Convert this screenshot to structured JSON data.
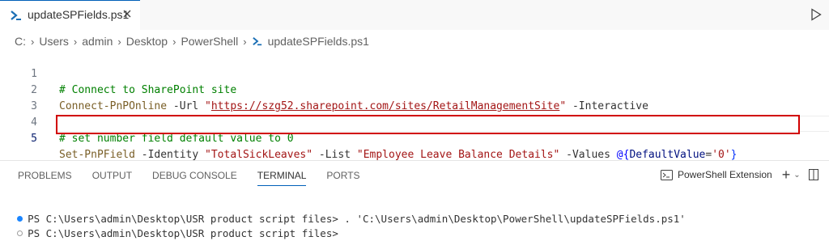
{
  "tab": {
    "filename": "updateSPFields.ps1"
  },
  "breadcrumb": [
    "C:",
    "Users",
    "admin",
    "Desktop",
    "PowerShell",
    "updateSPFields.ps1"
  ],
  "editor": {
    "lines": [
      {
        "num": "1",
        "comment": "# Connect to SharePoint site"
      },
      {
        "num": "2",
        "cmd": "Connect-PnPOnline",
        "p1": " -Url ",
        "q1": "\"",
        "url": "https://szg52.sharepoint.com/sites/RetailManagementSite",
        "q2": "\"",
        "p2": " -Interactive"
      },
      {
        "num": "3"
      },
      {
        "num": "4",
        "comment": "# set number field default value to 0"
      },
      {
        "num": "5",
        "cmd": "Set-PnPField",
        "p1": " -Identity ",
        "s1": "\"TotalSickLeaves\"",
        "p2": " -List ",
        "s2": "\"Employee Leave Balance Details\"",
        "p3": " -Values ",
        "at": "@{",
        "key": "DefaultValue",
        "eq": "=",
        "val": "'0'",
        "close": "}"
      }
    ]
  },
  "panel": {
    "tabs": [
      "PROBLEMS",
      "OUTPUT",
      "DEBUG CONSOLE",
      "TERMINAL",
      "PORTS"
    ],
    "active_tab": "TERMINAL",
    "shell_label": "PowerShell Extension",
    "plus": "+",
    "chevron": "⌄"
  },
  "terminal": {
    "line1": "PS C:\\Users\\admin\\Desktop\\USR product script files> . 'C:\\Users\\admin\\Desktop\\PowerShell\\updateSPFields.ps1'",
    "line2": "PS C:\\Users\\admin\\Desktop\\USR product script files>"
  },
  "colors": {
    "accent": "#005fb8",
    "highlight_box": "#d10000",
    "status_dot": "#1a85ff"
  }
}
